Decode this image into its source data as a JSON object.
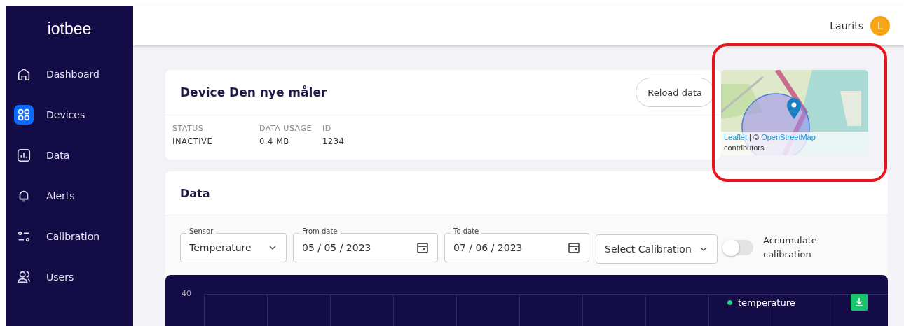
{
  "sidebar": {
    "logo": "iotbee",
    "items": [
      {
        "kind": "home",
        "label": "Dashboard",
        "selected": false
      },
      {
        "kind": "grid",
        "label": "Devices",
        "selected": true
      },
      {
        "kind": "chart",
        "label": "Data",
        "selected": false
      },
      {
        "kind": "bell",
        "label": "Alerts",
        "selected": false
      },
      {
        "kind": "sliders",
        "label": "Calibration",
        "selected": false
      },
      {
        "kind": "users",
        "label": "Users",
        "selected": false
      }
    ]
  },
  "header": {
    "user": "Laurits",
    "avatar": "L"
  },
  "device": {
    "title": "Device Den nye måler",
    "reload": "Reload data",
    "columns": [
      {
        "heading": "STATUS",
        "values": [
          "INACTIVE"
        ]
      },
      {
        "heading": "DATA USAGE",
        "values": [
          "0.4 MB"
        ]
      },
      {
        "heading": "ID",
        "values": [
          "1234"
        ]
      }
    ]
  },
  "map": {
    "attribution": {
      "leaflet": "Leaflet",
      "separator": "| ©",
      "osm": "OpenStreetMap",
      "rest": "contributors"
    }
  },
  "data": {
    "title": "Data",
    "filters": [
      {
        "kind": "select",
        "label": "Sensor",
        "value": "Temperature"
      },
      {
        "kind": "date",
        "label": "From date",
        "value": "05 / 05 / 2023"
      },
      {
        "kind": "date",
        "label": "To date",
        "value": "07 / 06 / 2023"
      },
      {
        "kind": "select",
        "value": "Select Calibration"
      }
    ],
    "toggle": {
      "label": "Accumulate calibration",
      "on": false
    },
    "chart": {
      "ytick": "40",
      "legend": [
        {
          "label": "temperature",
          "color": "#1fd17f"
        }
      ]
    }
  }
}
